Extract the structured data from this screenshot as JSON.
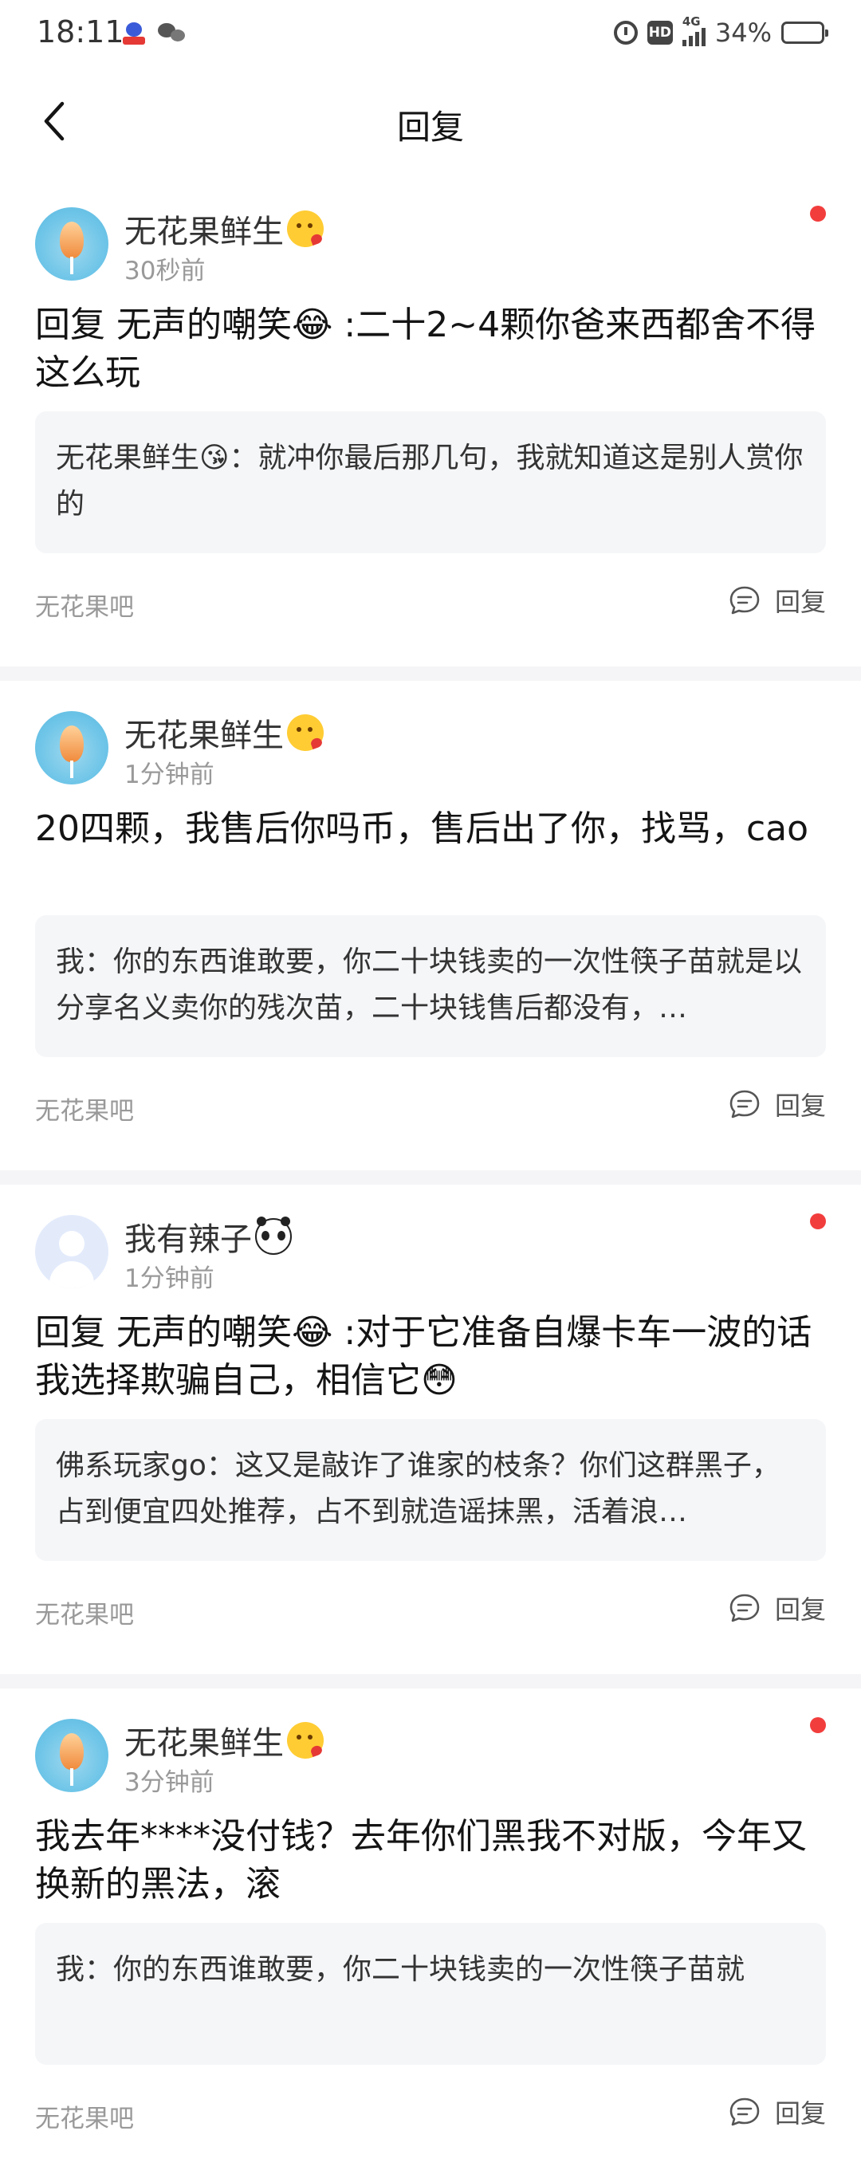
{
  "status_bar": {
    "time": "18:11",
    "network": "4G",
    "hd": "HD",
    "battery": "34%"
  },
  "nav": {
    "title": "回复"
  },
  "posts": [
    {
      "username": "无花果鲜生",
      "user_emoji": "face-blowing-kiss",
      "time": "30秒前",
      "unread": true,
      "content": "回复  无声的嘲笑😂 :二十2~4颗你爸来西都舍不得这么玩",
      "quote": "无花果鲜生😘：就冲你最后那几句，我就知道这是别人赏你的",
      "forum": "无花果吧",
      "reply_label": "回复"
    },
    {
      "username": "无花果鲜生",
      "user_emoji": "face-blowing-kiss",
      "time": "1分钟前",
      "unread": false,
      "content": "20四颗，我售后你吗币，售后出了你，找骂，cao",
      "quote": "我：你的东西谁敢要，你二十块钱卖的一次性筷子苗就是以分享名义卖你的残次苗，二十块钱售后都没有，…",
      "forum": "无花果吧",
      "reply_label": "回复"
    },
    {
      "username": "我有辣子",
      "user_emoji": "panda",
      "time": "1分钟前",
      "unread": true,
      "content": "回复  无声的嘲笑😂 :对于它准备自爆卡车一波的话我选择欺骗自己，相信它😳",
      "quote": "佛系玩家go：这又是敲诈了谁家的枝条？你们这群黑子，占到便宜四处推荐，占不到就造谣抹黑，活着浪…",
      "forum": "无花果吧",
      "reply_label": "回复"
    },
    {
      "username": "无花果鲜生",
      "user_emoji": "face-blowing-kiss",
      "time": "3分钟前",
      "unread": true,
      "content": "我去年****没付钱？去年你们黑我不对版，今年又换新的黑法，滚",
      "quote": "我：你的东西谁敢要，你二十块钱卖的一次性筷子苗就",
      "forum": "无花果吧",
      "reply_label": "回复"
    }
  ]
}
